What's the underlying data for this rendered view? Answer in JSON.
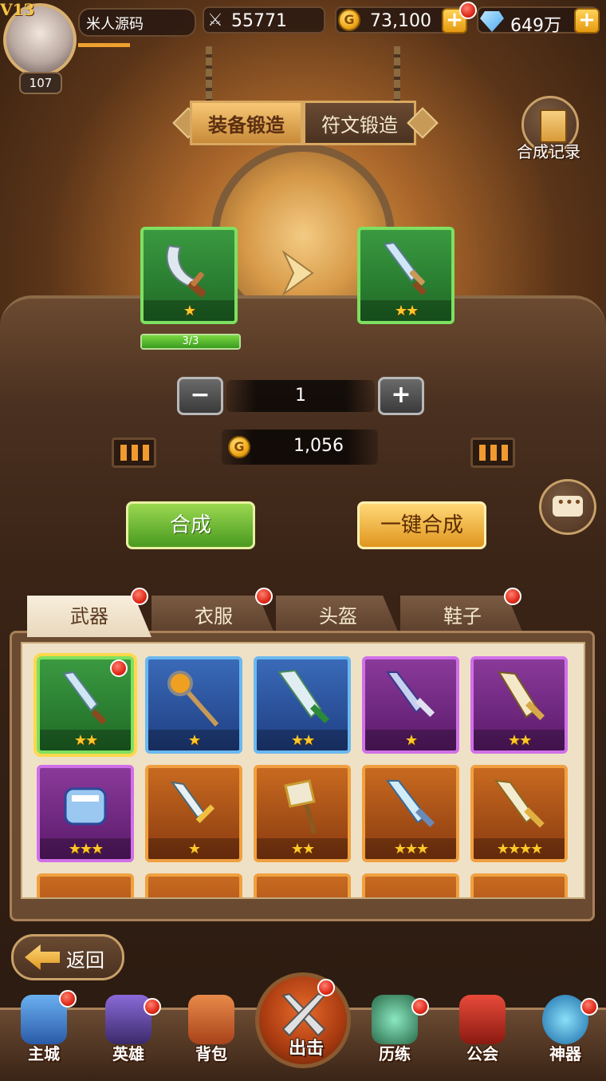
{
  "player": {
    "vip": "V13",
    "name": "米人源码",
    "level": "107",
    "exp_fraction": 0.45
  },
  "currency": {
    "power": "55771",
    "gold": "73,100",
    "diamonds": "649万"
  },
  "forge_tabs": [
    "装备锻造",
    "符文锻造"
  ],
  "record_label": "合成记录",
  "synthesis": {
    "material_progress": "3/3",
    "material_fraction": 1.0,
    "quantity": "1",
    "cost": "1,056",
    "synthesize_label": "合成",
    "one_click_label": "一键合成",
    "source_stars": 1,
    "result_stars": 2
  },
  "equipment_tabs": [
    "武器",
    "衣服",
    "头盔",
    "鞋子"
  ],
  "back_label": "返回",
  "nav": {
    "items": [
      "主城",
      "英雄",
      "背包",
      "出击",
      "历练",
      "公会",
      "神器"
    ]
  },
  "colors": {
    "accent_gold": "#f0a818",
    "red_dot": "#e02a1a",
    "rarity_green": "#3a9a40",
    "rarity_blue": "#3a6ab8",
    "rarity_purple": "#8a3a9a",
    "rarity_orange": "#c86a20"
  }
}
